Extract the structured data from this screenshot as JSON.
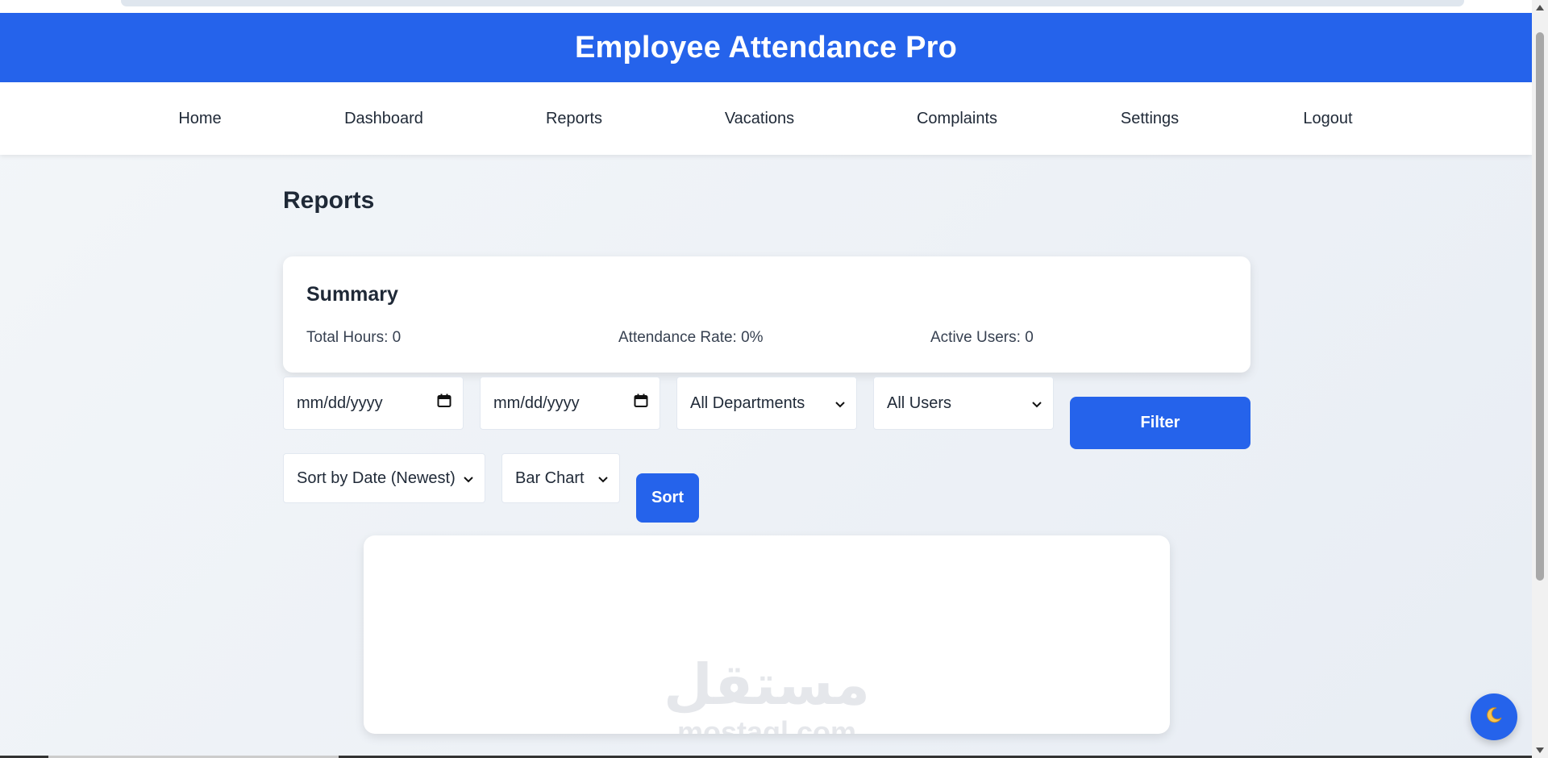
{
  "app": {
    "title": "Employee Attendance Pro",
    "accent_color": "#2563eb"
  },
  "nav": {
    "items": [
      {
        "label": "Home"
      },
      {
        "label": "Dashboard"
      },
      {
        "label": "Reports"
      },
      {
        "label": "Vacations"
      },
      {
        "label": "Complaints"
      },
      {
        "label": "Settings"
      },
      {
        "label": "Logout"
      }
    ]
  },
  "page": {
    "title": "Reports"
  },
  "summary": {
    "heading": "Summary",
    "total_hours": "Total Hours: 0",
    "attendance_rate": "Attendance Rate: 0%",
    "active_users": "Active Users: 0"
  },
  "filters": {
    "start_date_placeholder": "mm/dd/yyyy",
    "end_date_placeholder": "mm/dd/yyyy",
    "department_selected": "All Departments",
    "user_selected": "All Users",
    "filter_button": "Filter",
    "sort_selected": "Sort by Date (Newest)",
    "chart_type_selected": "Bar Chart",
    "sort_button": "Sort"
  },
  "watermark": {
    "arabic": "مستقل",
    "domain": "mostaql.com"
  },
  "icons": {
    "date_picker": "calendar-icon",
    "dropdown": "chevron-down-icon",
    "theme_toggle": "moon-icon"
  }
}
